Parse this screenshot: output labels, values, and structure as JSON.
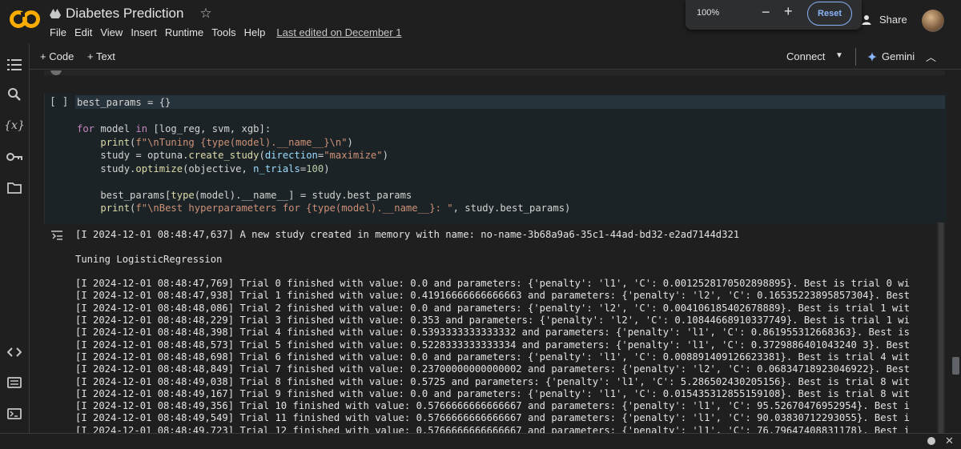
{
  "app": {
    "title": "Diabetes Prediction",
    "menu": [
      "File",
      "Edit",
      "View",
      "Insert",
      "Runtime",
      "Tools",
      "Help"
    ],
    "last_edited": "Last edited on December 1",
    "share_label": "Share",
    "colors": {
      "accent": "#8ab4f8",
      "logo_orange": "#f9ab00",
      "background": "#1f1f1f"
    }
  },
  "zoom": {
    "value": "100%",
    "minus": "−",
    "plus": "+",
    "reset_label": "Reset"
  },
  "toolbar": {
    "code_label": "Code",
    "text_label": "Text",
    "connect_label": "Connect",
    "gemini_label": "Gemini"
  },
  "sidebar": {
    "icons": [
      "table-of-contents-icon",
      "search-icon",
      "variables-icon",
      "secrets-key-icon",
      "files-folder-icon",
      "code-snippets-icon",
      "command-palette-icon",
      "terminal-icon"
    ]
  },
  "cell": {
    "bracket": "[ ]",
    "lines": [
      "best_params = {}",
      "",
      "for model in [log_reg, svm, xgb]:",
      "    print(f\"\\nTuning {type(model).__name__}\\n\")",
      "    study = optuna.create_study(direction=\"maximize\")",
      "    study.optimize(objective, n_trials=100)",
      "",
      "    best_params[type(model).__name__] = study.best_params",
      "    print(f\"\\nBest hyperparameters for {type(model).__name__}: \", study.best_params)"
    ]
  },
  "output": {
    "lines": [
      "[I 2024-12-01 08:48:47,637] A new study created in memory with name: no-name-3b68a9a6-35c1-44ad-bd32-e2ad7144d321",
      "",
      "Tuning LogisticRegression",
      "",
      "[I 2024-12-01 08:48:47,769] Trial 0 finished with value: 0.0 and parameters: {'penalty': 'l1', 'C': 0.0012528170502898895}. Best is trial 0 wi",
      "[I 2024-12-01 08:48:47,938] Trial 1 finished with value: 0.41916666666666663 and parameters: {'penalty': 'l2', 'C': 0.16535223895857304}. Best",
      "[I 2024-12-01 08:48:48,086] Trial 2 finished with value: 0.0 and parameters: {'penalty': 'l2', 'C': 0.004106185402678889}. Best is trial 1 wit",
      "[I 2024-12-01 08:48:48,229] Trial 3 finished with value: 0.353 and parameters: {'penalty': 'l2', 'C': 0.10844668910337749}. Best is trial 1 wi",
      "[I 2024-12-01 08:48:48,398] Trial 4 finished with value: 0.5393333333333332 and parameters: {'penalty': 'l1', 'C': 0.861955312668363}. Best is",
      "[I 2024-12-01 08:48:48,573] Trial 5 finished with value: 0.5228333333333334 and parameters: {'penalty': 'l1', 'C': 0.3729886401043240 3}. Best",
      "[I 2024-12-01 08:48:48,698] Trial 6 finished with value: 0.0 and parameters: {'penalty': 'l1', 'C': 0.008891409126623381}. Best is trial 4 wit",
      "[I 2024-12-01 08:48:48,849] Trial 7 finished with value: 0.23700000000000002 and parameters: {'penalty': 'l2', 'C': 0.06834718923046922}. Best",
      "[I 2024-12-01 08:48:49,038] Trial 8 finished with value: 0.5725 and parameters: {'penalty': 'l1', 'C': 5.286502430205156}. Best is trial 8 wit",
      "[I 2024-12-01 08:48:49,167] Trial 9 finished with value: 0.0 and parameters: {'penalty': 'l1', 'C': 0.015435312855159108}. Best is trial 8 wit",
      "[I 2024-12-01 08:48:49,356] Trial 10 finished with value: 0.5766666666666667 and parameters: {'penalty': 'l1', 'C': 95.52670476952954}. Best i",
      "[I 2024-12-01 08:48:49,549] Trial 11 finished with value: 0.5766666666666667 and parameters: {'penalty': 'l1', 'C': 90.03830712293055}. Best i",
      "[I 2024-12-01 08:48:49,723] Trial 12 finished with value: 0.5766666666666667 and parameters: {'penalty': 'l1', 'C': 76.79647408831178}. Best i"
    ]
  }
}
